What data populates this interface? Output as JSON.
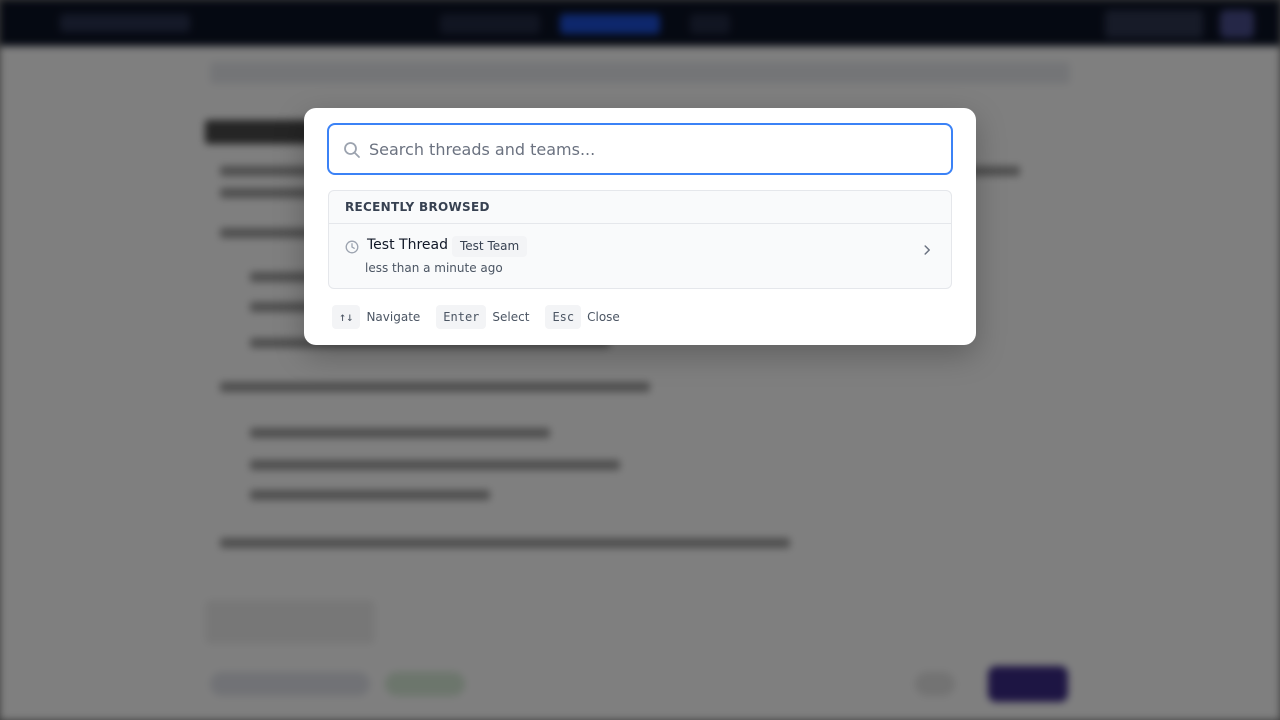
{
  "search": {
    "placeholder": "Search threads and teams...",
    "value": ""
  },
  "recent": {
    "header": "RECENTLY BROWSED",
    "items": [
      {
        "title": "Test Thread",
        "team": "Test Team",
        "time": "less than a minute ago"
      }
    ]
  },
  "hints": [
    {
      "key": "↑↓",
      "label": "Navigate"
    },
    {
      "key": "Enter",
      "label": "Select"
    },
    {
      "key": "Esc",
      "label": "Close"
    }
  ],
  "colors": {
    "focus_ring": "#3b82f6",
    "overlay": "#000000",
    "nav_background": "#0b1224",
    "primary_button": "#3b2a86"
  },
  "icons": {
    "search": "search-icon",
    "clock": "clock-icon",
    "chevron": "chevron-right-icon"
  }
}
